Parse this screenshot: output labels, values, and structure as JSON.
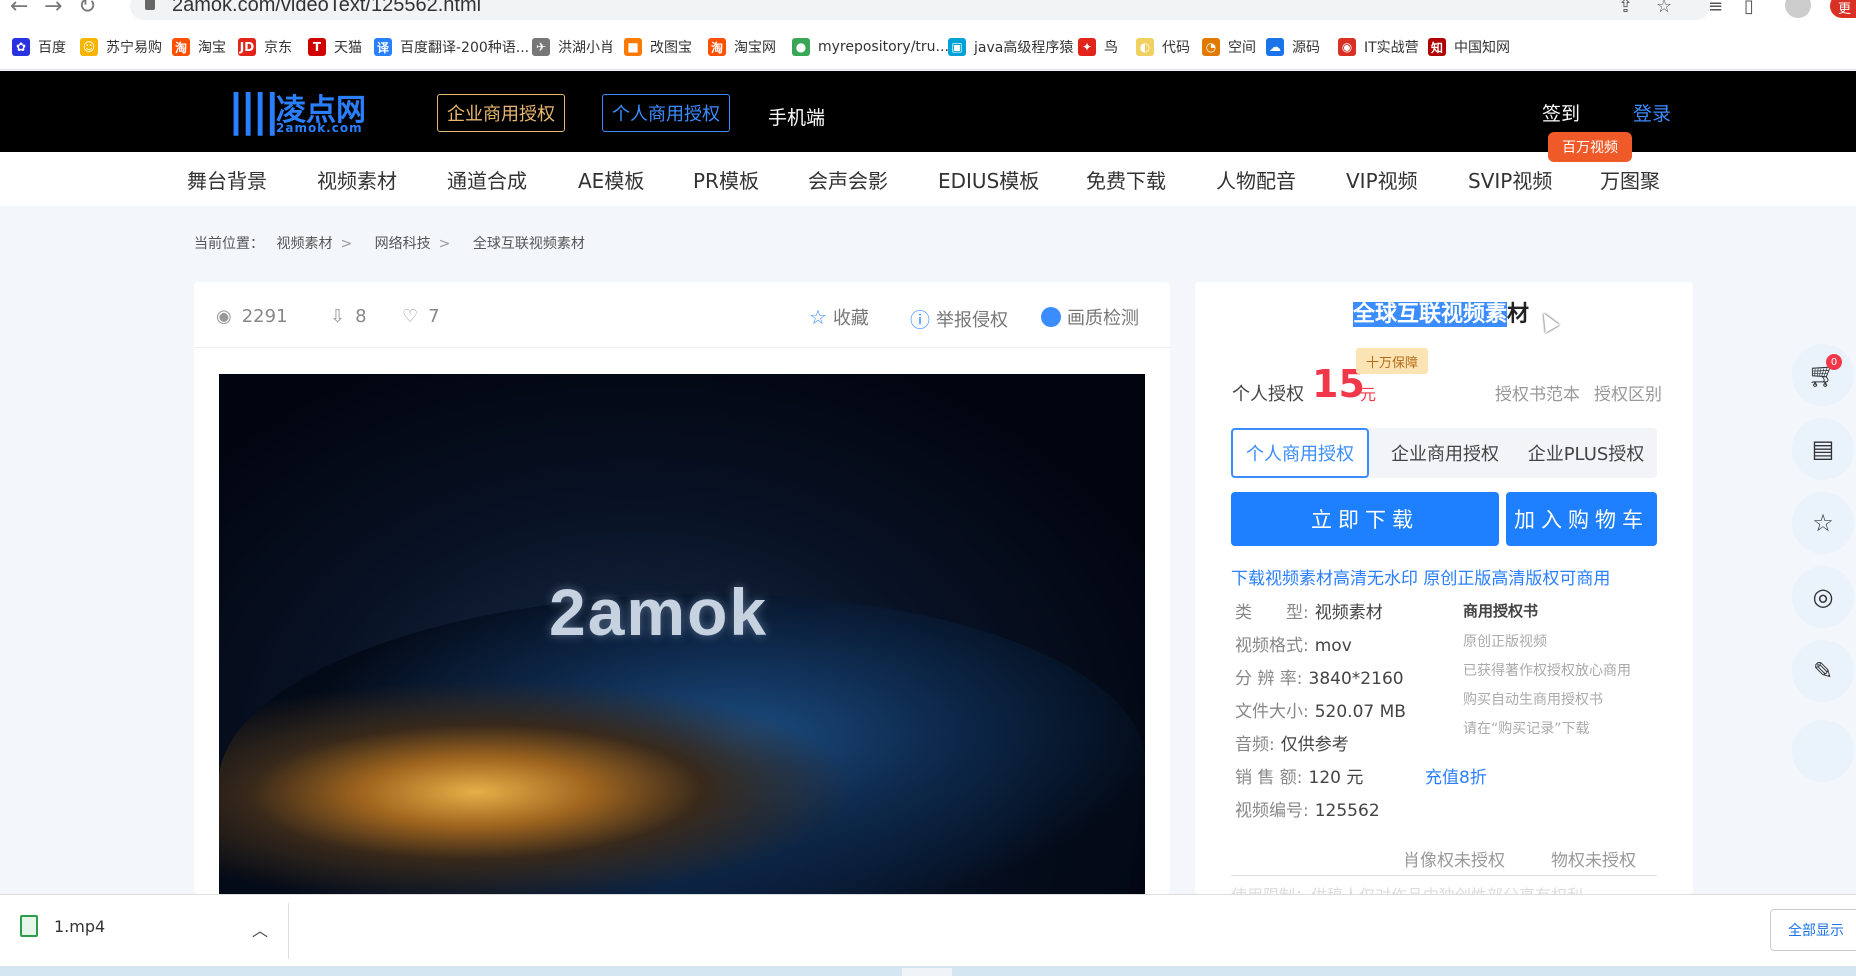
{
  "browser": {
    "url": "2amok.com/videoText/125562.html",
    "update_label": "更"
  },
  "bookmarks": [
    {
      "label": "百度",
      "color": "#2932e1",
      "glyph": "✿"
    },
    {
      "label": "苏宁易购",
      "color": "#f7b500",
      "glyph": "☺"
    },
    {
      "label": "淘宝",
      "color": "#ff5000",
      "glyph": "淘"
    },
    {
      "label": "京东",
      "color": "#e1251b",
      "glyph": "JD"
    },
    {
      "label": "天猫",
      "color": "#d00000",
      "glyph": "T"
    },
    {
      "label": "百度翻译-200种语...",
      "color": "#2a7fff",
      "glyph": "译"
    },
    {
      "label": "洪湖小肖",
      "color": "#777777",
      "glyph": "✈"
    },
    {
      "label": "改图宝",
      "color": "#ff7a00",
      "glyph": "■"
    },
    {
      "label": "淘宝网",
      "color": "#ff5000",
      "glyph": "淘"
    },
    {
      "label": "myrepository/tru...",
      "color": "#3aa757",
      "glyph": "●"
    },
    {
      "label": "java高级程序猿",
      "color": "#00a1d6",
      "glyph": "▣"
    },
    {
      "label": "鸟",
      "color": "#e1251b",
      "glyph": "✦"
    },
    {
      "label": "代码",
      "color": "#f0d060",
      "glyph": "◐"
    },
    {
      "label": "空间",
      "color": "#e07b00",
      "glyph": "◔"
    },
    {
      "label": "源码",
      "color": "#1a73e8",
      "glyph": "☁"
    },
    {
      "label": "IT实战营",
      "color": "#d93025",
      "glyph": "◉"
    },
    {
      "label": "中国知网",
      "color": "#b00000",
      "glyph": "知"
    }
  ],
  "header": {
    "logo_cn": "凌点网",
    "logo_en": "2amok.com",
    "enterprise_btn": "企业商用授权",
    "personal_btn": "个人商用授权",
    "mobile": "手机端",
    "sign_in": "签到",
    "login": "登录"
  },
  "catnav": {
    "items": [
      "舞台背景",
      "视频素材",
      "通道合成",
      "AE模板",
      "PR模板",
      "会声会影",
      "EDIUS模板",
      "免费下载",
      "人物配音",
      "VIP视频",
      "SVIP视频",
      "万图聚"
    ],
    "badge": "百万视频"
  },
  "breadcrumb": {
    "prefix": "当前位置：",
    "items": [
      "视频素材",
      "网络科技",
      "全球互联视频素材"
    ]
  },
  "stats": {
    "views": "2291",
    "downloads": "8",
    "likes": "7",
    "favorite": "收藏",
    "report": "举报侵权",
    "quality": "画质检测"
  },
  "video": {
    "watermark": "2amok"
  },
  "product": {
    "title_selected": "全球互联视频素",
    "title_rest": "材",
    "price_label": "个人授权",
    "price": "15",
    "price_unit": "元",
    "guarantee": "十万保障",
    "link_sample": "授权书范本",
    "link_diff": "授权区别",
    "tabs": [
      "个人商用授权",
      "企业商用授权",
      "企业PLUS授权"
    ],
    "download_btn": "立即下载",
    "cart_btn": "加入购物车",
    "promo": "下载视频素材高清无水印 原创正版高清版权可商用",
    "info": [
      {
        "label": "类　　型:",
        "value": "视频素材"
      },
      {
        "label": "视频格式:",
        "value": "mov"
      },
      {
        "label": "分 辨 率:",
        "value": "3840*2160"
      },
      {
        "label": "文件大小:",
        "value": "520.07 MB"
      },
      {
        "label": "音频:",
        "value": "仅供参考"
      },
      {
        "label": "销 售 额:",
        "value": "120 元",
        "extra": "充值8折"
      },
      {
        "label": "视频编号:",
        "value": "125562"
      }
    ],
    "cert_title": "商用授权书",
    "cert_lines": [
      "原创正版视频",
      "已获得著作权授权放心商用",
      "购买自动生商用授权书",
      "请在“购买记录”下载"
    ],
    "rights_portrait": "肖像权未授权",
    "rights_property": "物权未授权",
    "usage_faded": "使用限制：供稿人仅对作品中独创性部分享有权利"
  },
  "sidebar": {
    "cart_count": "0"
  },
  "download_shelf": {
    "file": "1.mp4",
    "show_all": "全部显示"
  }
}
